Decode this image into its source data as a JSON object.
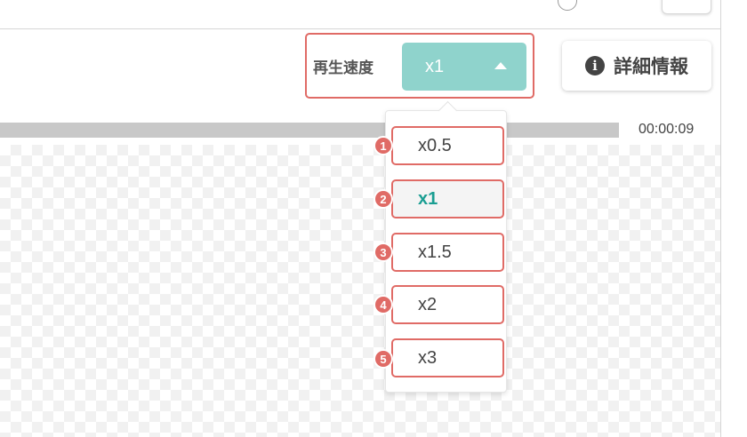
{
  "player": {
    "speed_label": "再生速度",
    "speed_value": "x1",
    "detail_button": "詳細情報",
    "time": "00:00:09"
  },
  "speed_menu": {
    "options": [
      "x0.5",
      "x1",
      "x1.5",
      "x2",
      "x3"
    ],
    "selected": "x1",
    "badges": [
      "1",
      "2",
      "3",
      "4",
      "5"
    ]
  },
  "colors": {
    "accent": "#8fd3cc",
    "selected_text": "#1a9e92",
    "highlight": "#e06b66"
  },
  "icons": {
    "info": "info-circle-icon",
    "caret": "caret-up-icon"
  }
}
